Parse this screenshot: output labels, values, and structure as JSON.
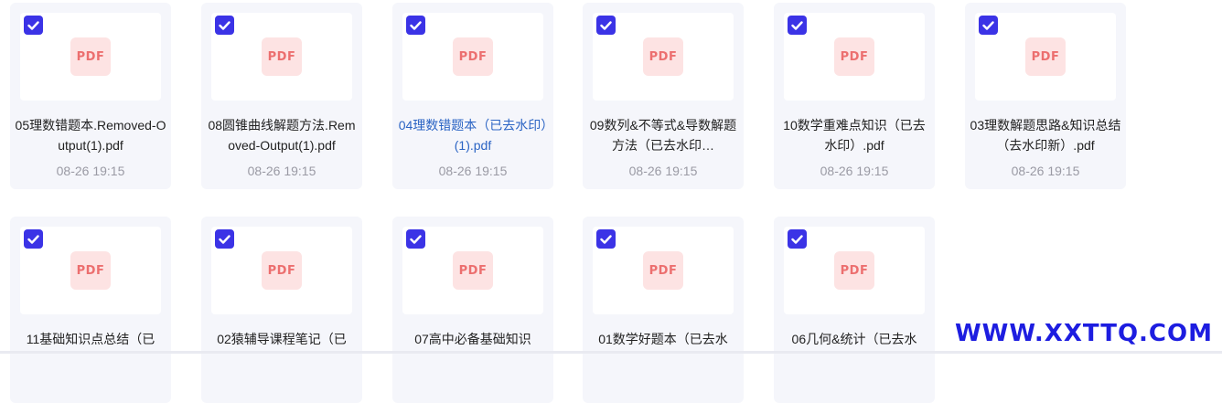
{
  "files": [
    {
      "name": "05理数错题本.Removed-Output(1).pdf",
      "time": "08-26 19:15",
      "icon": "PDF",
      "checked": true
    },
    {
      "name": "08圆锥曲线解题方法.Removed-Output(1).pdf",
      "time": "08-26 19:15",
      "icon": "PDF",
      "checked": true
    },
    {
      "name": "04理数错题本（已去水印）(1).pdf",
      "time": "08-26 19:15",
      "icon": "PDF",
      "checked": true
    },
    {
      "name": "09数列&不等式&导数解题方法（已去水印…",
      "time": "08-26 19:15",
      "icon": "PDF",
      "checked": true
    },
    {
      "name": "10数学重难点知识（已去水印）.pdf",
      "time": "08-26 19:15",
      "icon": "PDF",
      "checked": true
    },
    {
      "name": "03理数解题思路&知识总结（去水印新）.pdf",
      "time": "08-26 19:15",
      "icon": "PDF",
      "checked": true
    },
    {
      "name": "11基础知识点总结（已",
      "time": "",
      "icon": "PDF",
      "checked": true
    },
    {
      "name": "02猿辅导课程笔记（已",
      "time": "",
      "icon": "PDF",
      "checked": true
    },
    {
      "name": "07高中必备基础知识",
      "time": "",
      "icon": "PDF",
      "checked": true
    },
    {
      "name": "01数学好题本（已去水",
      "time": "",
      "icon": "PDF",
      "checked": true
    },
    {
      "name": "06几何&统计（已去水",
      "time": "",
      "icon": "PDF",
      "checked": true
    }
  ],
  "watermark": "WWW.XXTTQ.COM",
  "colors": {
    "checkbox": "#3b33e6",
    "card_bg": "#f5f6fb",
    "pdf_bg": "#fde3e3",
    "pdf_text": "#ec6f6f",
    "link": "#2b64c4",
    "watermark": "#1d1de0"
  }
}
